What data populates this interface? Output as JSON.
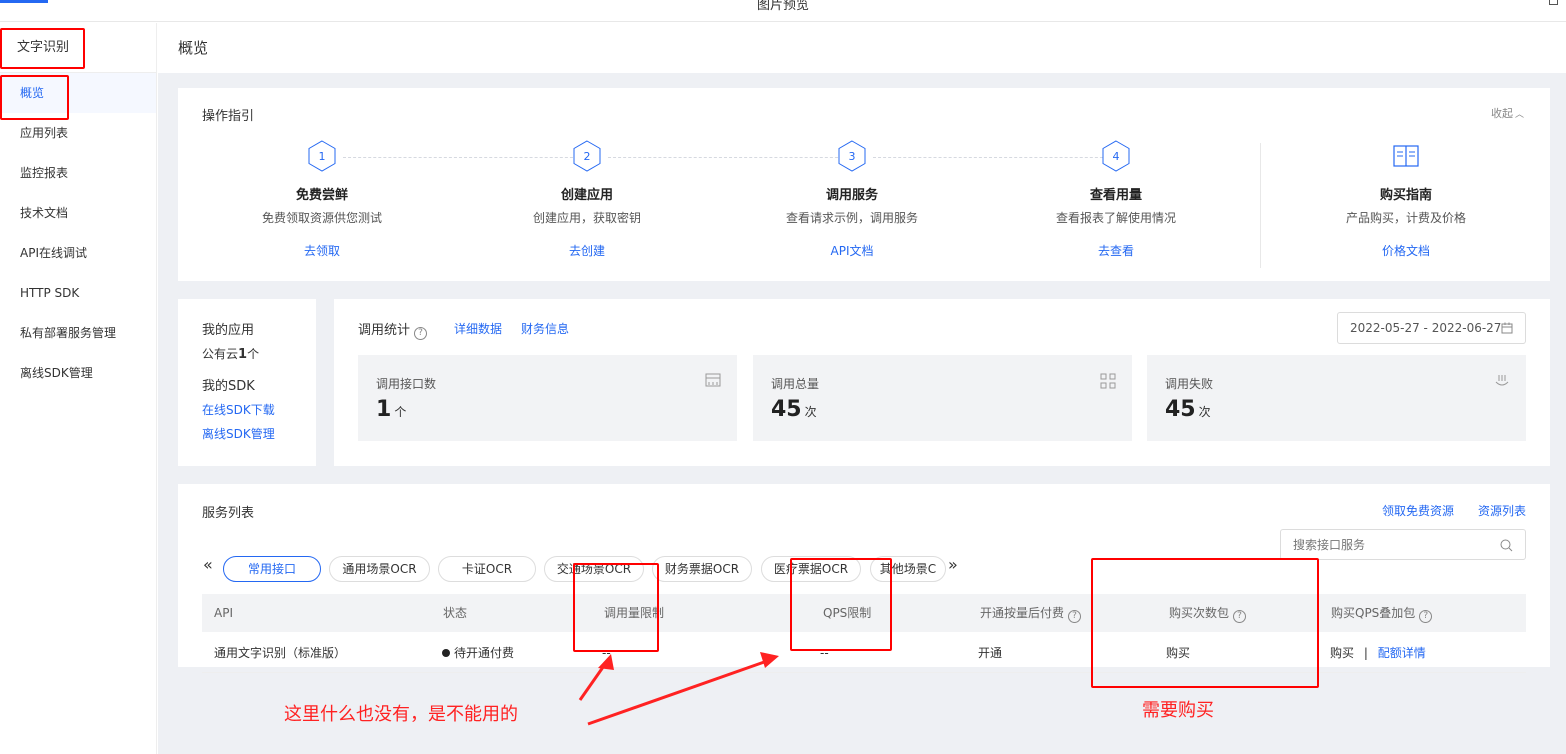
{
  "window": {
    "title": "图片预览"
  },
  "sidebar": {
    "header": "文字识别",
    "items": [
      {
        "label": "概览",
        "active": true
      },
      {
        "label": "应用列表"
      },
      {
        "label": "监控报表"
      },
      {
        "label": "技术文档"
      },
      {
        "label": "API在线调试"
      },
      {
        "label": "HTTP SDK"
      },
      {
        "label": "私有部署服务管理"
      },
      {
        "label": "离线SDK管理"
      }
    ]
  },
  "page": {
    "title": "概览"
  },
  "guide": {
    "title": "操作指引",
    "collapse": "收起",
    "steps": [
      {
        "num": "1",
        "title": "免费尝鲜",
        "desc": "免费领取资源供您测试",
        "link": "去领取"
      },
      {
        "num": "2",
        "title": "创建应用",
        "desc": "创建应用，获取密钥",
        "link": "去创建"
      },
      {
        "num": "3",
        "title": "调用服务",
        "desc": "查看请求示例，调用服务",
        "link": "API文档"
      },
      {
        "num": "4",
        "title": "查看用量",
        "desc": "查看报表了解使用情况",
        "link": "去查看"
      }
    ],
    "purchase": {
      "title": "购买指南",
      "desc": "产品购买，计费及价格",
      "link": "价格文档"
    }
  },
  "myapps": {
    "title": "我的应用",
    "cloud_prefix": "公有云",
    "cloud_count": "1",
    "cloud_suffix": "个",
    "sdk_title": "我的SDK",
    "sdk_link1": "在线SDK下载",
    "sdk_link2": "离线SDK管理"
  },
  "stats": {
    "title": "调用统计",
    "link_detail": "详细数据",
    "link_finance": "财务信息",
    "date_range": "2022-05-27 - 2022-06-27",
    "boxes": [
      {
        "label": "调用接口数",
        "value": "1",
        "unit": "个",
        "icon": "list-icon"
      },
      {
        "label": "调用总量",
        "value": "45",
        "unit": "次",
        "icon": "grid-icon"
      },
      {
        "label": "调用失败",
        "value": "45",
        "unit": "次",
        "icon": "failure-icon"
      }
    ]
  },
  "services": {
    "title": "服务列表",
    "link_free": "领取免费资源",
    "link_resources": "资源列表",
    "search_placeholder": "搜索接口服务",
    "tabs": [
      "常用接口",
      "通用场景OCR",
      "卡证OCR",
      "交通场景OCR",
      "财务票据OCR",
      "医疗票据OCR",
      "其他场景C"
    ],
    "columns": [
      "API",
      "状态",
      "调用量限制",
      "QPS限制",
      "开通按量后付费",
      "购买次数包",
      "购买QPS叠加包"
    ],
    "row": {
      "api": "通用文字识别（标准版）",
      "status": "待开通付费",
      "call_limit": "--",
      "qps_limit": "--",
      "pay_after": "开通",
      "buy_pack": "购买",
      "buy_qps": "购买",
      "separator": "|",
      "quota_detail": "配额详情"
    }
  },
  "annotations": {
    "note_left": "这里什么也没有，是不能用的",
    "note_right": "需要购买",
    "color": "#ff2020"
  }
}
